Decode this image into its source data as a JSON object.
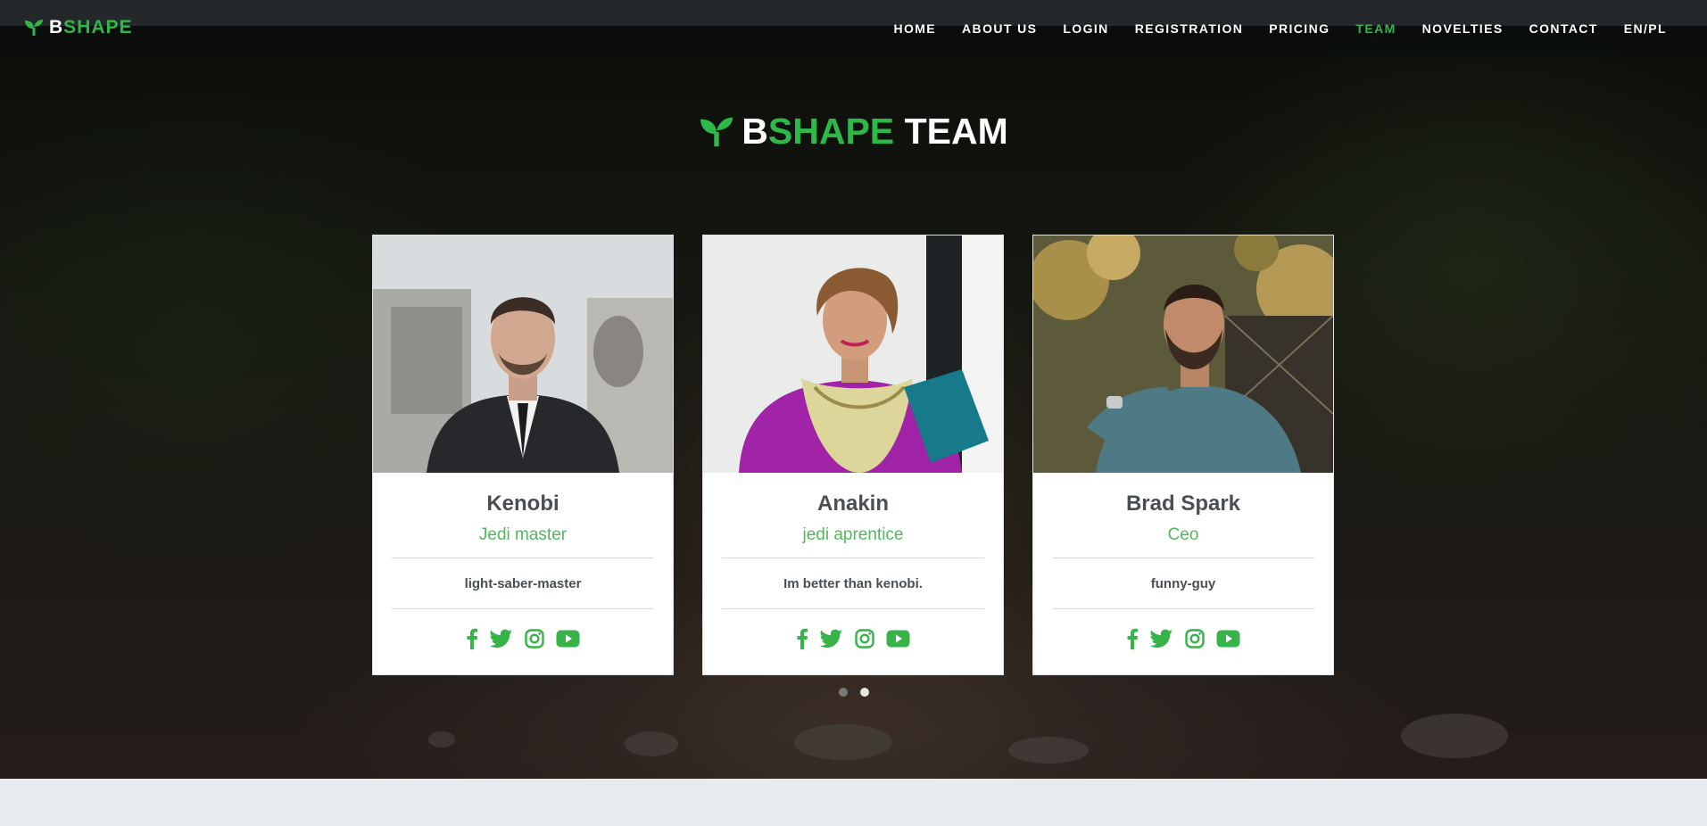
{
  "brand": {
    "b": "B",
    "rest": "SHAPE"
  },
  "nav": {
    "items": [
      {
        "label": "HOME"
      },
      {
        "label": "ABOUT US"
      },
      {
        "label": "LOGIN"
      },
      {
        "label": "REGISTRATION"
      },
      {
        "label": "PRICING"
      },
      {
        "label": "TEAM",
        "active": true
      },
      {
        "label": "NOVELTIES"
      },
      {
        "label": "CONTACT"
      },
      {
        "label": "EN/PL"
      }
    ]
  },
  "section": {
    "title_b": "B",
    "title_shape": "SHAPE",
    "title_team": "TEAM"
  },
  "team": [
    {
      "name": "Kenobi",
      "role": "Jedi master",
      "motto": "light-saber-master"
    },
    {
      "name": "Anakin",
      "role": "jedi aprentice",
      "motto": "Im better than kenobi."
    },
    {
      "name": "Brad Spark",
      "role": "Ceo",
      "motto": "funny-guy"
    }
  ],
  "carousel": {
    "pages": 2,
    "active_index": 1
  },
  "colors": {
    "accent_green": "#37b34a",
    "text_dark": "#4a4f55",
    "role_green": "#52b85a"
  },
  "icons": {
    "logo": "sprout-icon",
    "social": [
      "facebook-icon",
      "twitter-icon",
      "instagram-icon",
      "youtube-icon"
    ]
  }
}
